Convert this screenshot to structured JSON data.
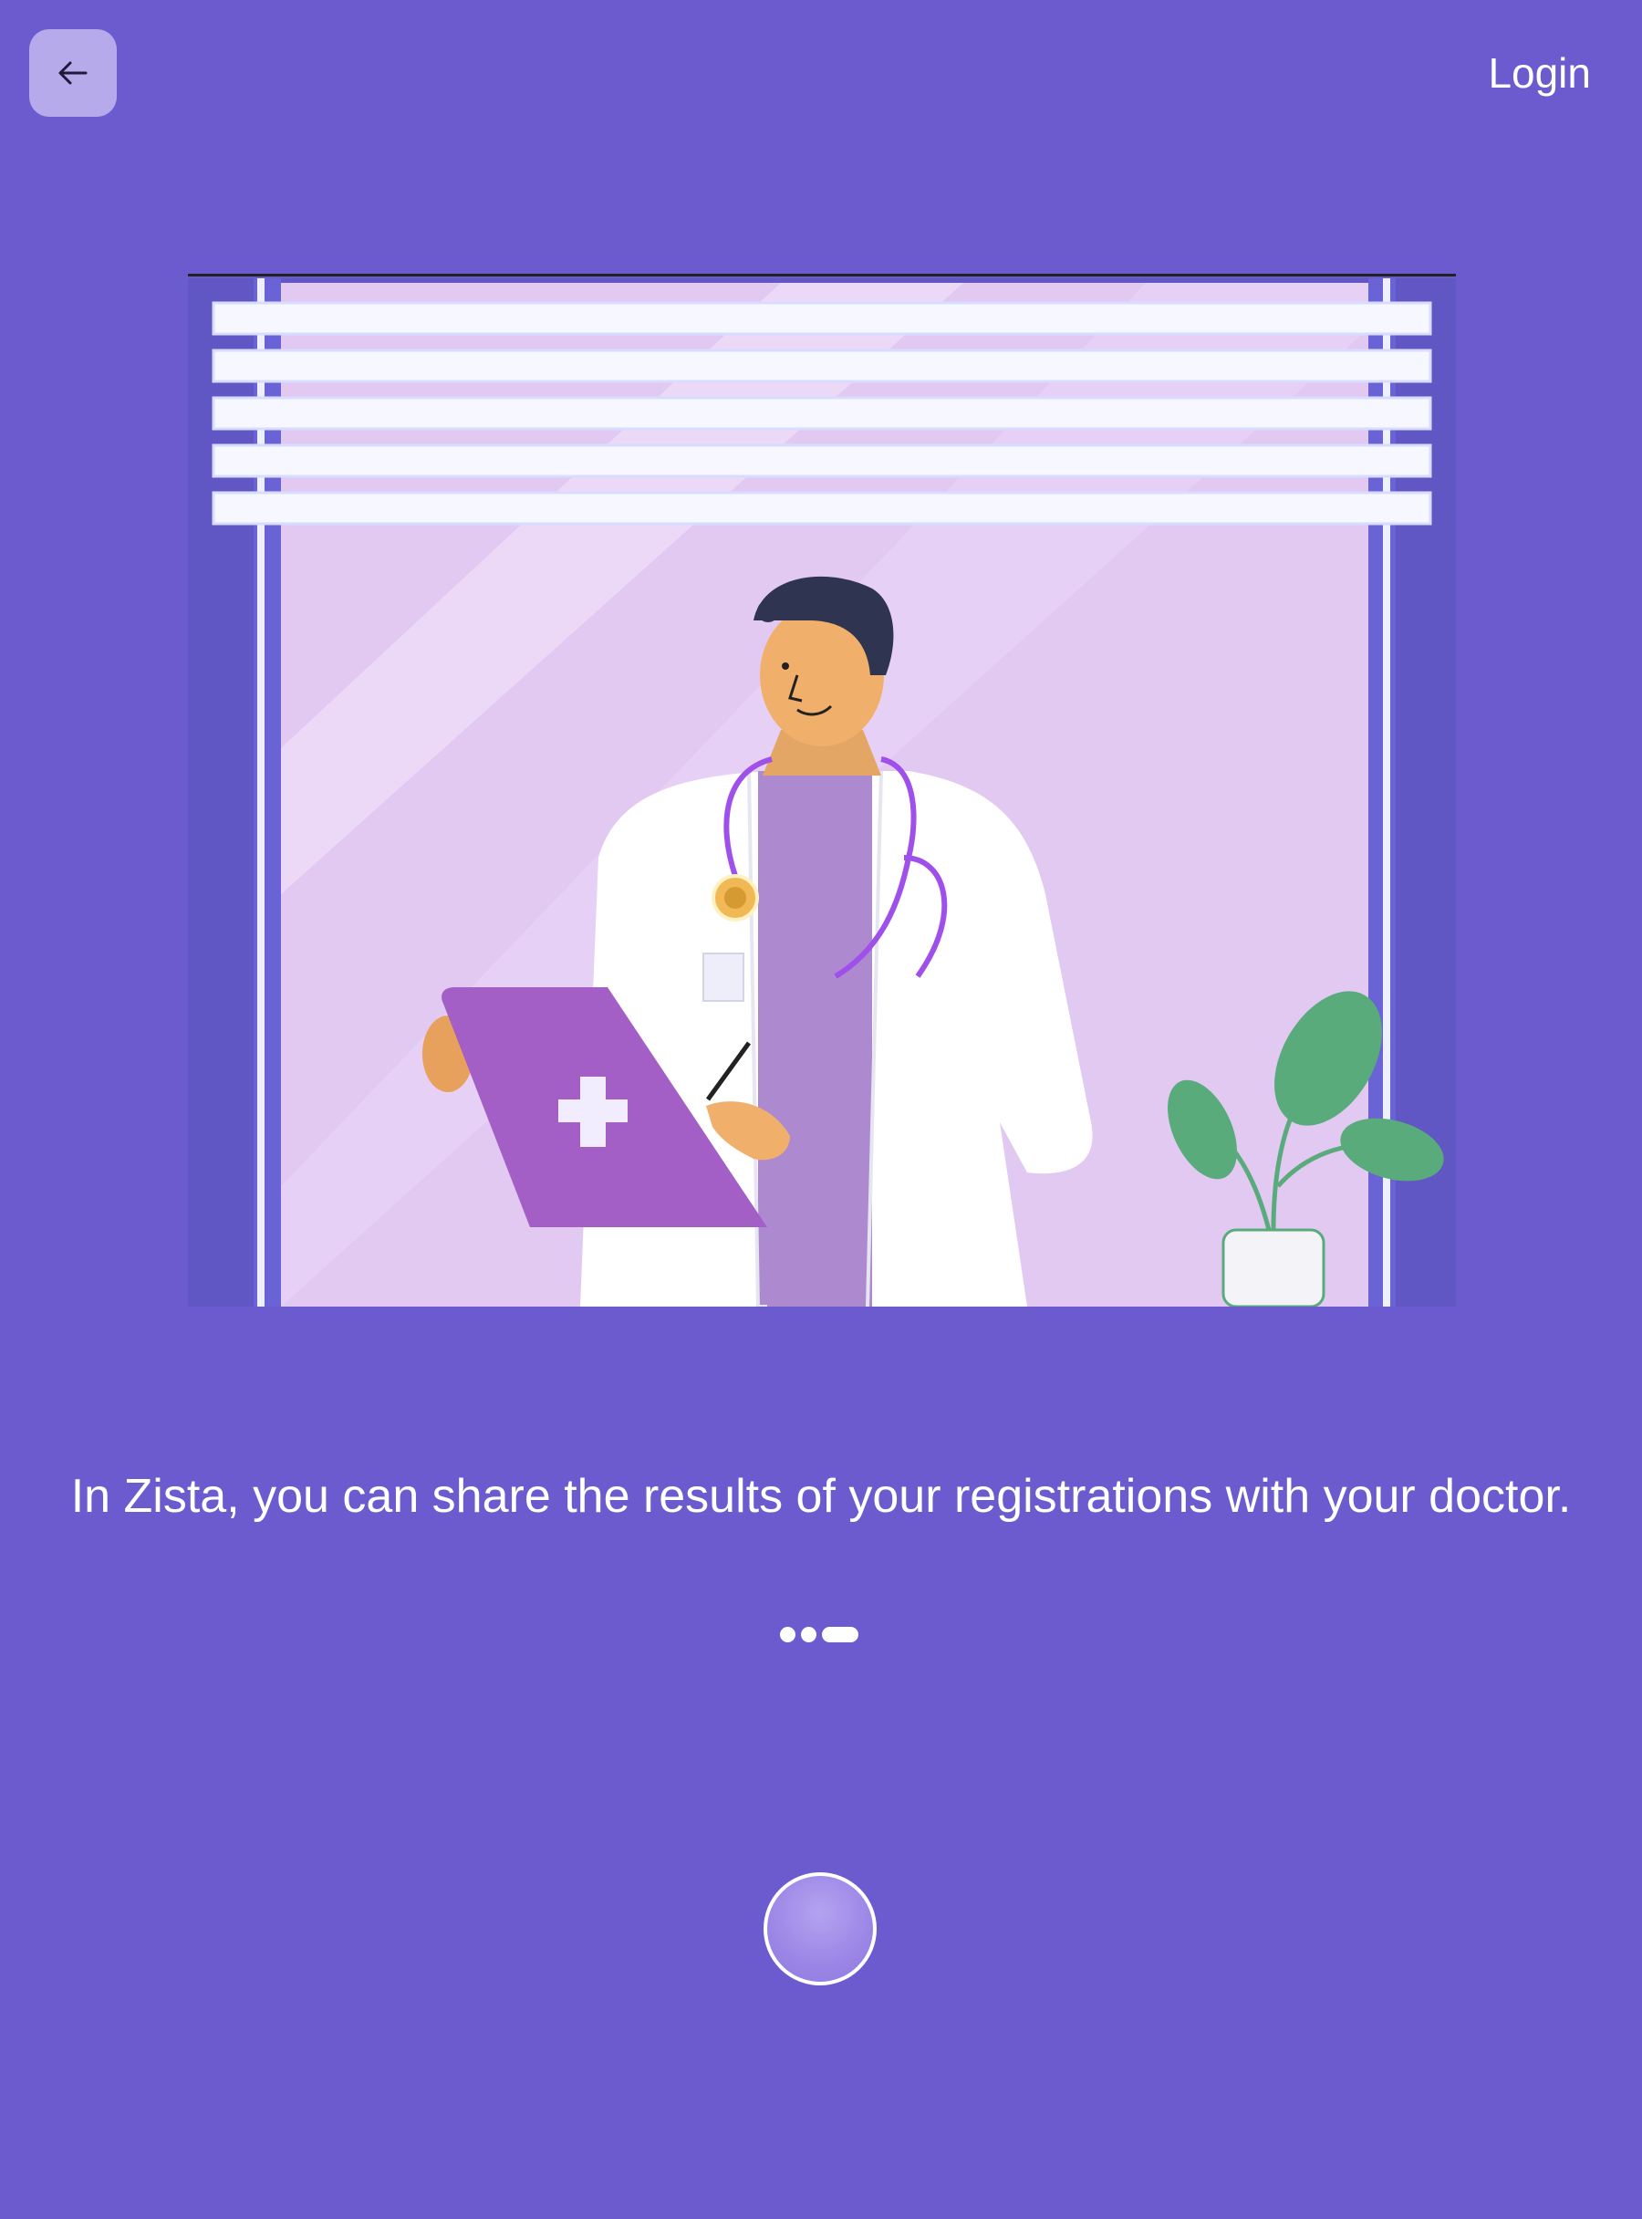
{
  "header": {
    "back_icon": "arrow-left-icon",
    "login_label": "Login"
  },
  "illustration": {
    "subject": "doctor-with-clipboard-illustration"
  },
  "onboarding": {
    "message": "In Zista, you can share the results of your registrations with your doctor.",
    "page_count": 3,
    "active_page": 3
  },
  "footer": {
    "next_button_icon": "circle-button-icon"
  },
  "colors": {
    "background": "#6b5bcf",
    "back_button_bg": "#b7aaea",
    "text": "#ffffff",
    "accent_purple": "#a35fc6",
    "plant_green": "#5aab7c"
  }
}
